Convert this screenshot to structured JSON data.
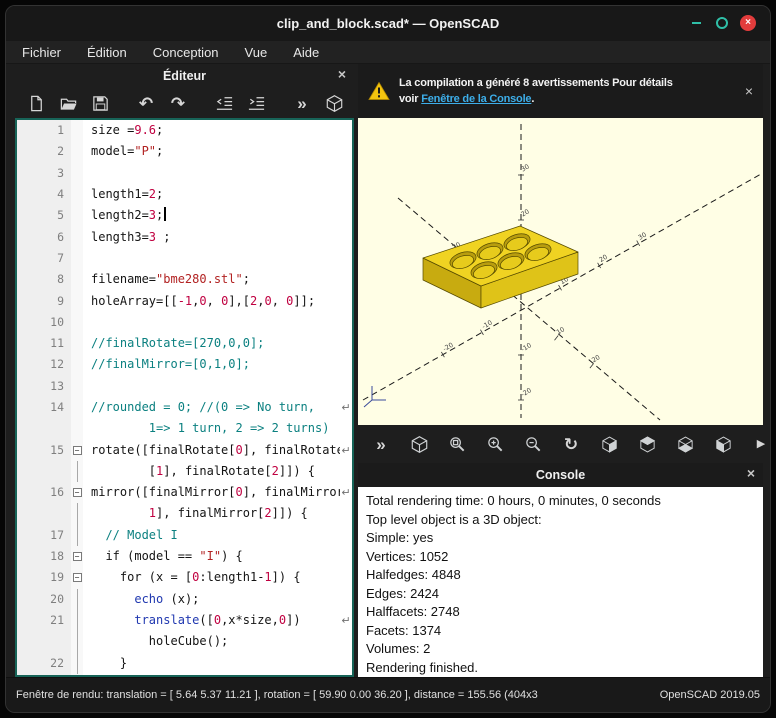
{
  "window": {
    "title": "clip_and_block.scad* — OpenSCAD"
  },
  "menu": {
    "items": [
      "Fichier",
      "Édition",
      "Conception",
      "Vue",
      "Aide"
    ]
  },
  "icons": {
    "undo": "↶",
    "redo": "↷",
    "preview": "»",
    "reset_view": "↻",
    "more": "▶",
    "wrap": "↵",
    "close": "×",
    "fold_collapse": "−"
  },
  "editor": {
    "title": "Éditeur",
    "rows": [
      {
        "n": "1",
        "t": [
          [
            "p",
            "size ="
          ],
          [
            "n",
            "9.6"
          ],
          [
            "p",
            ";"
          ]
        ]
      },
      {
        "n": "2",
        "t": [
          [
            "p",
            "model="
          ],
          [
            "s",
            "\"P\""
          ],
          [
            "p",
            ";"
          ]
        ]
      },
      {
        "n": "3",
        "t": []
      },
      {
        "n": "4",
        "t": [
          [
            "p",
            "length1="
          ],
          [
            "n",
            "2"
          ],
          [
            "p",
            ";"
          ]
        ]
      },
      {
        "n": "5",
        "cursor": true,
        "t": [
          [
            "p",
            "length2="
          ],
          [
            "n",
            "3"
          ],
          [
            "p",
            ";"
          ]
        ]
      },
      {
        "n": "6",
        "t": [
          [
            "p",
            "length3="
          ],
          [
            "n",
            "3"
          ],
          [
            "p",
            " ;"
          ]
        ]
      },
      {
        "n": "7",
        "t": []
      },
      {
        "n": "8",
        "t": [
          [
            "p",
            "filename="
          ],
          [
            "s",
            "\"bme280.stl\""
          ],
          [
            "p",
            ";"
          ]
        ]
      },
      {
        "n": "9",
        "t": [
          [
            "p",
            "holeArray=[["
          ],
          [
            "n",
            "-1"
          ],
          [
            "p",
            ","
          ],
          [
            "n",
            "0"
          ],
          [
            "p",
            ", "
          ],
          [
            "n",
            "0"
          ],
          [
            "p",
            "],["
          ],
          [
            "n",
            "2"
          ],
          [
            "p",
            ","
          ],
          [
            "n",
            "0"
          ],
          [
            "p",
            ", "
          ],
          [
            "n",
            "0"
          ],
          [
            "p",
            "]];"
          ]
        ]
      },
      {
        "n": "10",
        "t": []
      },
      {
        "n": "11",
        "t": [
          [
            "c",
            "//finalRotate=[270,0,0];"
          ]
        ]
      },
      {
        "n": "12",
        "t": [
          [
            "c",
            "//finalMirror=[0,1,0];"
          ]
        ]
      },
      {
        "n": "13",
        "t": []
      },
      {
        "n": "14",
        "wrap": true,
        "t": [
          [
            "c",
            "//rounded = 0; //(0 => No turn,"
          ]
        ]
      },
      {
        "n": "",
        "t": [
          [
            "c",
            "        1=> 1 turn, 2 => 2 turns)"
          ]
        ]
      },
      {
        "n": "15",
        "fold": true,
        "wrap": true,
        "t": [
          [
            "p",
            "rotate([finalRotate["
          ],
          [
            "n",
            "0"
          ],
          [
            "p",
            "], finalRotate"
          ]
        ]
      },
      {
        "n": "",
        "guide": true,
        "t": [
          [
            "p",
            "        ["
          ],
          [
            "n",
            "1"
          ],
          [
            "p",
            "], finalRotate["
          ],
          [
            "n",
            "2"
          ],
          [
            "p",
            "]]) {"
          ]
        ]
      },
      {
        "n": "16",
        "fold": true,
        "wrap": true,
        "t": [
          [
            "p",
            "mirror([finalMirror["
          ],
          [
            "n",
            "0"
          ],
          [
            "p",
            "], finalMirror["
          ]
        ]
      },
      {
        "n": "",
        "guide": true,
        "t": [
          [
            "p",
            "        "
          ],
          [
            "n",
            "1"
          ],
          [
            "p",
            "], finalMirror["
          ],
          [
            "n",
            "2"
          ],
          [
            "p",
            "]]) {"
          ]
        ]
      },
      {
        "n": "17",
        "guide": true,
        "t": [
          [
            "c",
            "  // Model I"
          ]
        ]
      },
      {
        "n": "18",
        "fold": true,
        "t": [
          [
            "p",
            "  if (model == "
          ],
          [
            "s",
            "\"I\""
          ],
          [
            "p",
            ") {"
          ]
        ]
      },
      {
        "n": "19",
        "fold": true,
        "t": [
          [
            "p",
            "    for (x = ["
          ],
          [
            "n",
            "0"
          ],
          [
            "p",
            ":length1-"
          ],
          [
            "n",
            "1"
          ],
          [
            "p",
            "]) {"
          ]
        ]
      },
      {
        "n": "20",
        "guide": true,
        "t": [
          [
            "p",
            "      "
          ],
          [
            "k",
            "echo"
          ],
          [
            "p",
            " (x);"
          ]
        ]
      },
      {
        "n": "21",
        "guide": true,
        "wrap": true,
        "t": [
          [
            "p",
            "      "
          ],
          [
            "k",
            "translate"
          ],
          [
            "p",
            "(["
          ],
          [
            "n",
            "0"
          ],
          [
            "p",
            ",x*size,"
          ],
          [
            "n",
            "0"
          ],
          [
            "p",
            "])"
          ]
        ]
      },
      {
        "n": "",
        "guide": true,
        "t": [
          [
            "p",
            "        holeCube();"
          ]
        ]
      },
      {
        "n": "22",
        "guide": true,
        "t": [
          [
            "p",
            "    }"
          ]
        ]
      }
    ]
  },
  "warning_banner": {
    "line1": "La compilation a généré 8 avertissements Pour détails",
    "line2_prefix": "voir ",
    "line2_link": "Fenêtre de la Console",
    "line2_suffix": "."
  },
  "viewport": {
    "x_tick_labels": [
      "10",
      "20",
      "30"
    ],
    "x_neg_tick_labels": [
      "-10",
      "-20"
    ],
    "z_tick_labels": [
      "10",
      "20",
      "30"
    ],
    "z_neg_tick_labels": [
      "-10",
      "-20"
    ],
    "y_tick_labels": [
      "10",
      "20"
    ],
    "y_neg_tick_labels": [
      "-10",
      "-20"
    ]
  },
  "console": {
    "title": "Console",
    "lines": [
      "Total rendering time: 0 hours, 0 minutes, 0 seconds",
      "Top level object is a 3D object:",
      "Simple: yes",
      "Vertices: 1052",
      "Halfedges: 4848",
      "Edges: 2424",
      "Halffacets: 2748",
      "Facets: 1374",
      "Volumes: 2",
      "Rendering finished."
    ]
  },
  "statusbar": {
    "left": "Fenêtre de rendu: translation = [ 5.64 5.37 11.21 ], rotation = [ 59.90 0.00 36.20 ], distance = 155.56 (404x3",
    "right": "OpenSCAD 2019.05"
  },
  "colors": {
    "accent": "#2fbfa7",
    "close_red": "#e23c3c",
    "link_blue": "#3daee9",
    "viewport_bg": "#fffee5",
    "object_top": "#f0d322",
    "object_left": "#c8ab10",
    "object_right": "#dfc318",
    "syntax_comment": "#0b8080",
    "syntax_number": "#c00040",
    "syntax_string": "#b22222",
    "syntax_keyword": "#2038b0"
  }
}
